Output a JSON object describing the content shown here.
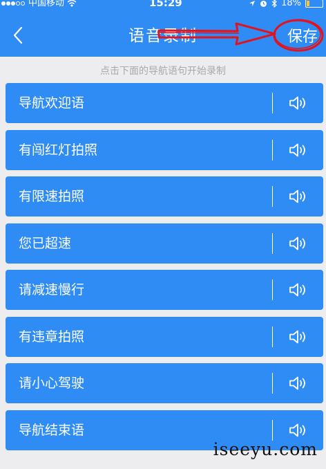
{
  "status_bar": {
    "carrier": "中国移动",
    "time": "15:29",
    "battery": "18%",
    "battery_level": 0.18,
    "icons": [
      "signal-icon",
      "wifi-icon",
      "location-icon",
      "alarm-icon",
      "bluetooth-icon",
      "battery-icon"
    ]
  },
  "header": {
    "title": "语音录制",
    "save_label": "保存",
    "back_icon": "chevron-left-icon",
    "background": "#2f8cf5",
    "annotation_color": "#e0141e"
  },
  "hint": "点击下面的导航语句开始录制",
  "items": [
    {
      "label": "导航欢迎语"
    },
    {
      "label": "有闯红灯拍照"
    },
    {
      "label": "有限速拍照"
    },
    {
      "label": "您已超速"
    },
    {
      "label": "请减速慢行"
    },
    {
      "label": "有违章拍照"
    },
    {
      "label": "请小心驾驶"
    },
    {
      "label": "导航结束语"
    }
  ],
  "watermark": "iseeyu.com"
}
